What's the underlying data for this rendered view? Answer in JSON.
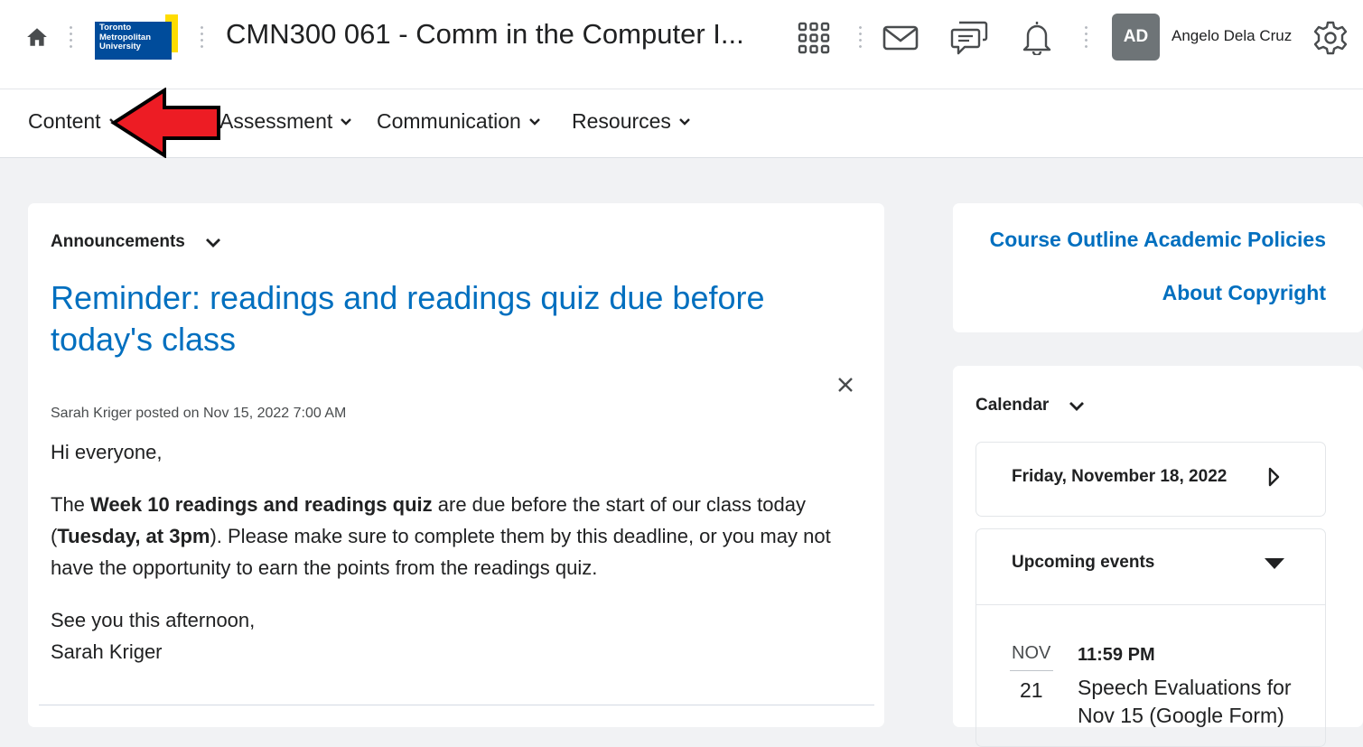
{
  "topbar": {
    "logo_lines": [
      "Toronto",
      "Metropolitan",
      "University"
    ],
    "course_title": "CMN300 061 - Comm in the Computer I...",
    "avatar_initials": "AD",
    "username": "Angelo Dela Cruz",
    "icons": [
      "home-icon",
      "waffle-grid-icon",
      "mail-icon",
      "chat-icon",
      "bell-icon",
      "gear-icon"
    ]
  },
  "nav": {
    "items": [
      {
        "label": "Content"
      },
      {
        "label": "Assessment"
      },
      {
        "label": "Communication"
      },
      {
        "label": "Resources"
      }
    ]
  },
  "announcements": {
    "header": "Announcements",
    "title": "Reminder: readings and readings quiz due before today's class",
    "meta": "Sarah Kriger posted on Nov 15, 2022 7:00 AM",
    "greeting": "Hi everyone,",
    "para_prefix": "The ",
    "para_bold1": "Week 10 readings and readings quiz",
    "para_mid": " are due before the start of our class today (",
    "para_bold2": "Tuesday, at 3pm",
    "para_suffix": "). Please make sure to complete them by this deadline, or you may not have the opportunity to earn the points from the readings quiz.",
    "signoff": "See you this afternoon,",
    "signature": "Sarah Kriger"
  },
  "links": {
    "course_outline": "Course Outline Academic Policies",
    "copyright": "About Copyright"
  },
  "calendar": {
    "header": "Calendar",
    "date": "Friday, November 18, 2022",
    "upcoming_label": "Upcoming events",
    "event": {
      "month": "NOV",
      "day": "21",
      "time": "11:59 PM",
      "title": "Speech Evaluations for Nov 15 (Google Form)"
    }
  },
  "colors": {
    "link_blue": "#006fbf",
    "arrow_red": "#ed1c24",
    "logo_blue": "#004c9b",
    "logo_yellow": "#ffdc00"
  }
}
